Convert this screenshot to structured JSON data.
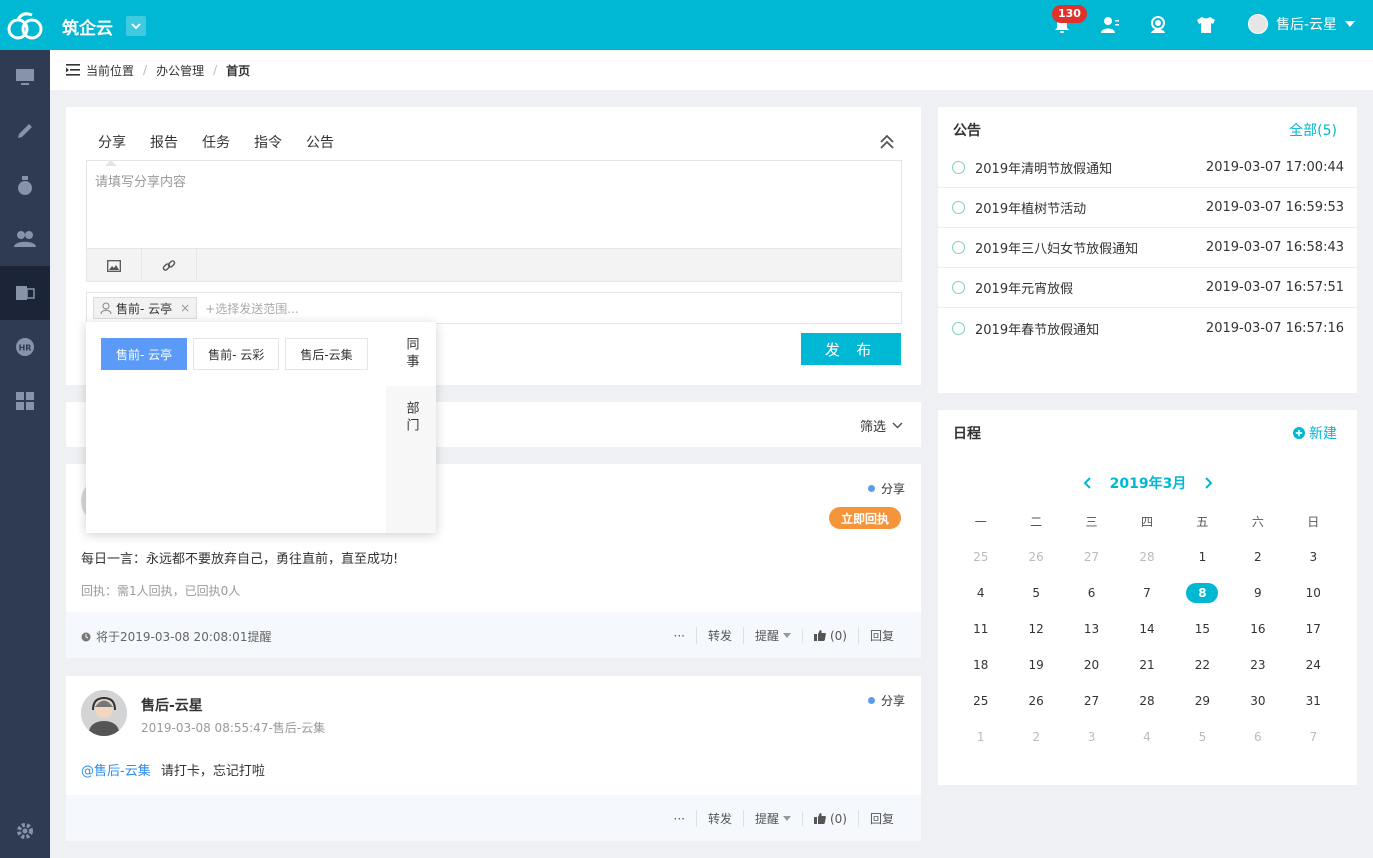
{
  "app": {
    "brand": "筑企云"
  },
  "header": {
    "notification_count": "130",
    "user_name": "售后-云星"
  },
  "breadcrumb": {
    "label": "当前位置",
    "items": [
      "办公管理",
      "首页"
    ]
  },
  "composer": {
    "tabs": [
      "分享",
      "报告",
      "任务",
      "指令",
      "公告"
    ],
    "placeholder": "请填写分享内容",
    "range_chip": "售前- 云亭",
    "range_placeholder": "+选择发送范围...",
    "publish_label": "发 布"
  },
  "popover": {
    "people": [
      "售前- 云亭",
      "售前- 云彩",
      "售后-云集"
    ],
    "tabs": [
      "同事",
      "部门"
    ]
  },
  "feed": {
    "filter_label": "筛选",
    "posts": [
      {
        "type": "分享",
        "ack_button": "立即回执",
        "text": "每日一言：永远都不要放弃自己，勇往直前，直至成功!",
        "receipt": "回执：需1人回执，已回执0人",
        "reminder": "将于2019-03-08 20:08:01提醒",
        "actions": {
          "more": "···",
          "forward": "转发",
          "remind": "提醒",
          "like": "(0)",
          "reply": "回复"
        }
      },
      {
        "type": "分享",
        "author": "售后-云星",
        "meta": "2019-03-08 08:55:47-售后-云集",
        "mention": "@售后-云集",
        "text": "请打卡，忘记打啦",
        "actions": {
          "more": "···",
          "forward": "转发",
          "remind": "提醒",
          "like": "(0)",
          "reply": "回复"
        }
      }
    ]
  },
  "notices": {
    "title": "公告",
    "all_link": "全部(5)",
    "items": [
      {
        "title": "2019年清明节放假通知",
        "date": "2019-03-07 17:00:44"
      },
      {
        "title": "2019年植树节活动",
        "date": "2019-03-07 16:59:53"
      },
      {
        "title": "2019年三八妇女节放假通知",
        "date": "2019-03-07 16:58:43"
      },
      {
        "title": "2019年元宵放假",
        "date": "2019-03-07 16:57:51"
      },
      {
        "title": "2019年春节放假通知",
        "date": "2019-03-07 16:57:16"
      }
    ]
  },
  "schedule": {
    "title": "日程",
    "new_label": "新建",
    "month_label": "2019年3月",
    "weekdays": [
      "一",
      "二",
      "三",
      "四",
      "五",
      "六",
      "日"
    ],
    "today": "8",
    "days": [
      [
        "25",
        "26",
        "27",
        "28",
        "1",
        "2",
        "3"
      ],
      [
        "4",
        "5",
        "6",
        "7",
        "8",
        "9",
        "10"
      ],
      [
        "11",
        "12",
        "13",
        "14",
        "15",
        "16",
        "17"
      ],
      [
        "18",
        "19",
        "20",
        "21",
        "22",
        "23",
        "24"
      ],
      [
        "25",
        "26",
        "27",
        "28",
        "29",
        "30",
        "31"
      ],
      [
        "1",
        "2",
        "3",
        "4",
        "5",
        "6",
        "7"
      ]
    ]
  },
  "colors": {
    "accent": "#00b8d4",
    "sidebar": "#2f3b52",
    "selected": "#5b9bf7",
    "ack": "#f5953a",
    "badge": "#e0312a"
  }
}
